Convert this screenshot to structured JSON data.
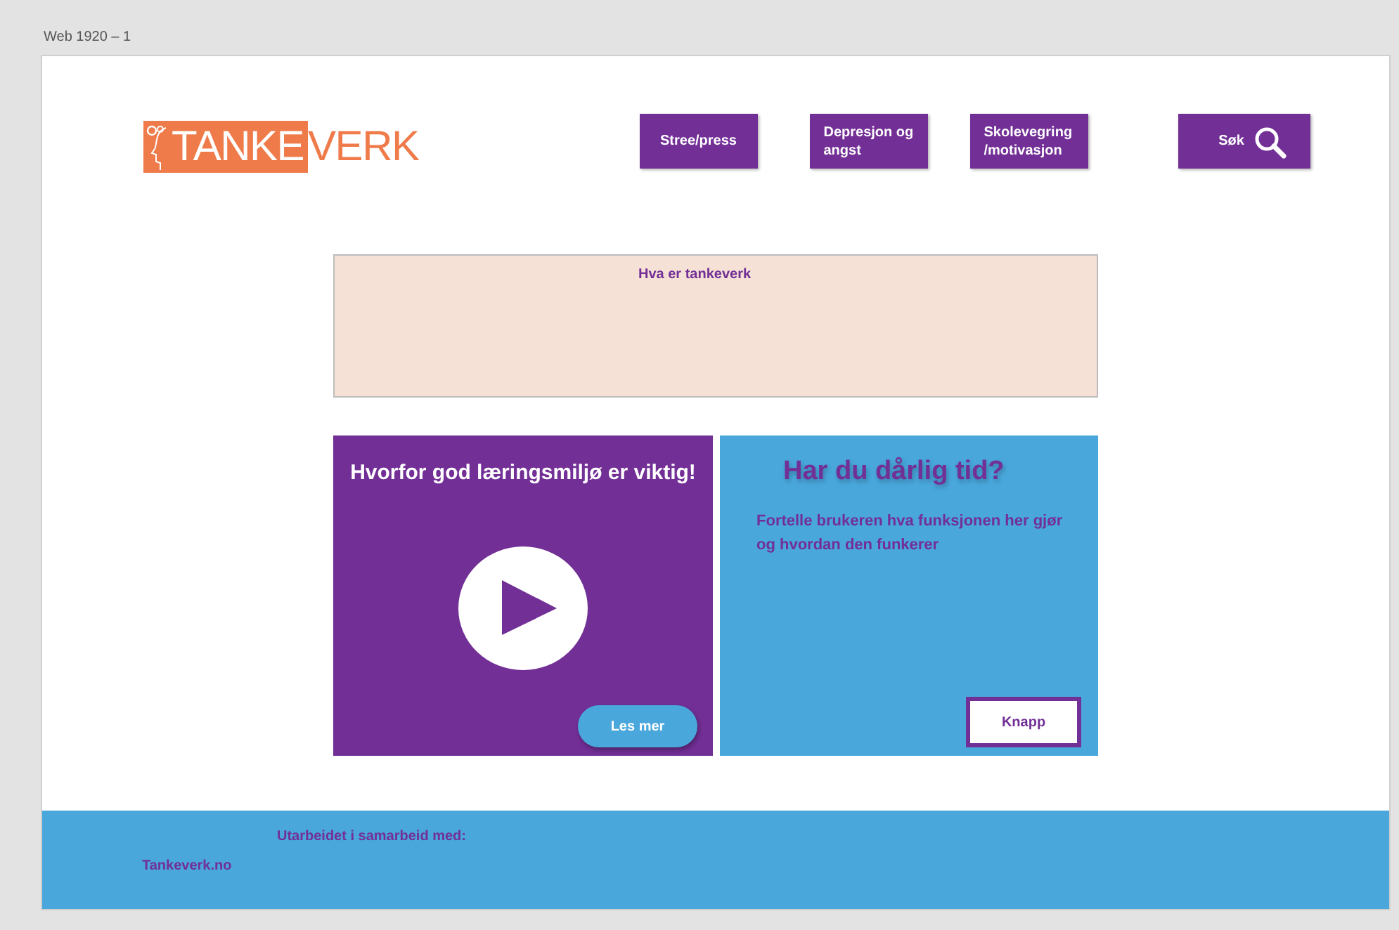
{
  "artboard": {
    "title": "Web 1920 – 1"
  },
  "logo": {
    "part_1": "TANKE",
    "part_2": "VERK"
  },
  "nav": [
    {
      "label": "Stree/press"
    },
    {
      "label": "Depresjon og angst"
    },
    {
      "label": "Skolevegring /motivasjon"
    }
  ],
  "search_button": {
    "label": "Søk"
  },
  "info_box": {
    "title": "Hva er tankeverk"
  },
  "video_card": {
    "title": "Hvorfor god læringsmiljø er viktig!",
    "button": "Les mer"
  },
  "time_card": {
    "title": "Har du dårlig tid?",
    "text": "Fortelle brukeren hva funksjonen her gjør og hvordan den funkerer",
    "button": "Knapp"
  },
  "footer": {
    "credit": "Utarbeidet i samarbeid med:",
    "link": "Tankeverk.no"
  }
}
